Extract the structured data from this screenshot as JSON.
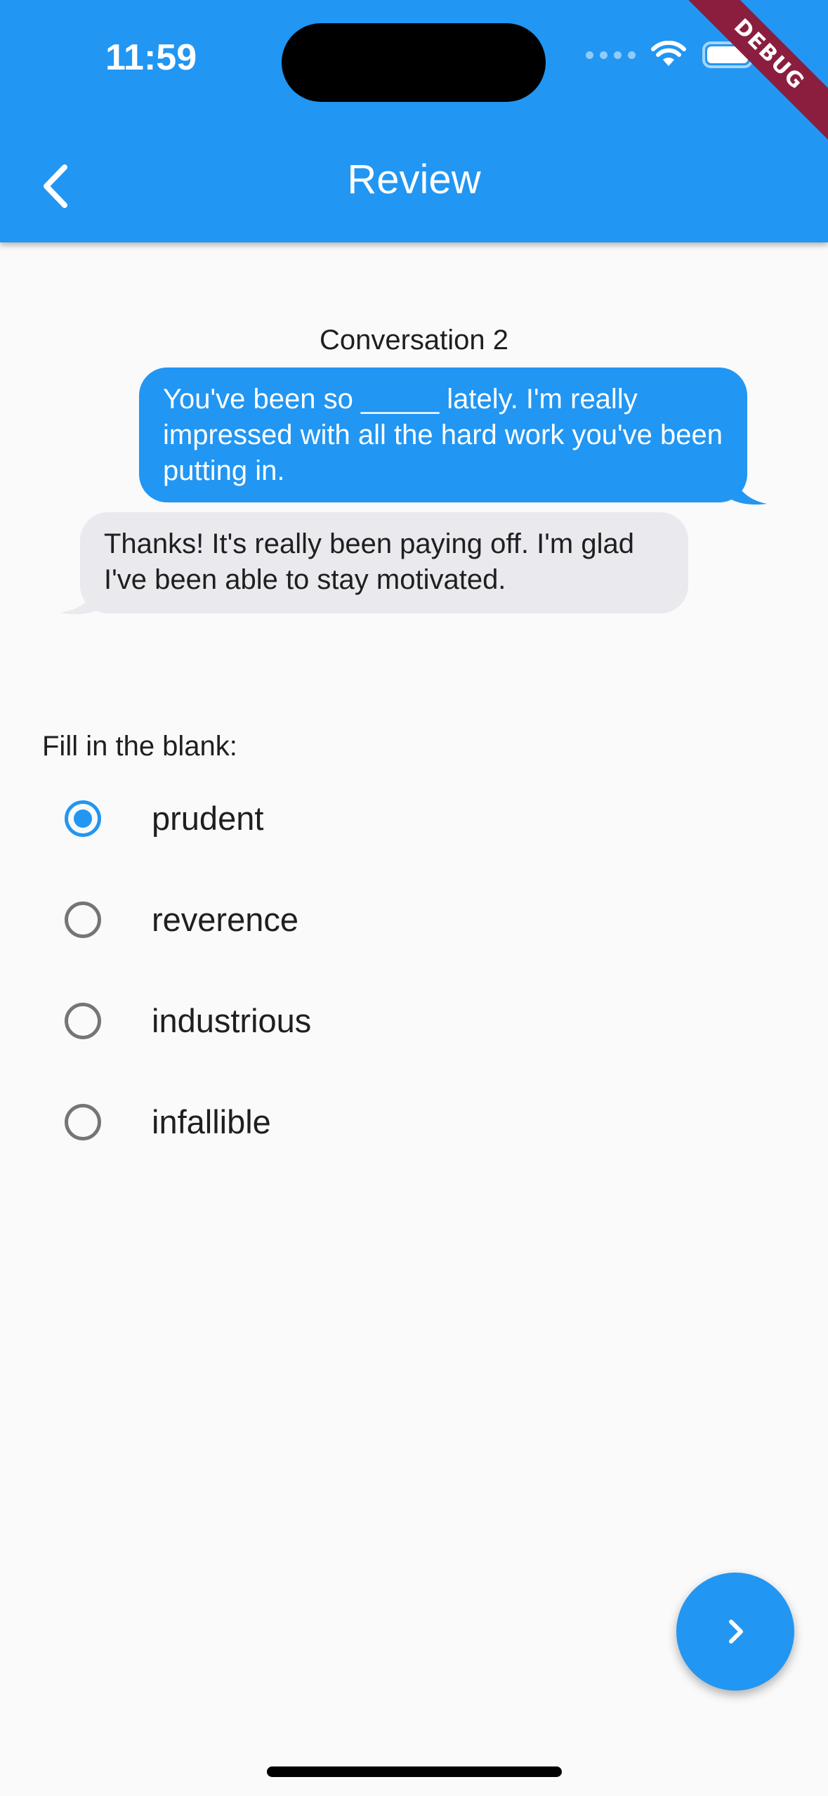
{
  "status_bar": {
    "time": "11:59",
    "debug_label": "DEBUG"
  },
  "app_bar": {
    "title": "Review",
    "back_icon": "chevron-left-icon",
    "background_color": "#2196f3"
  },
  "conversation": {
    "title": "Conversation 2",
    "messages": [
      {
        "side": "right",
        "text": "You've been so _____ lately. I'm really impressed with all the hard work you've been putting in."
      },
      {
        "side": "left",
        "text": "Thanks! It's really been paying off. I'm glad I've been able to stay motivated."
      }
    ]
  },
  "question": {
    "prompt": "Fill in the blank:",
    "options": [
      "prudent",
      "reverence",
      "industrious",
      "infallible"
    ],
    "selected": "prudent"
  },
  "fab": {
    "icon": "chevron-right-icon"
  },
  "colors": {
    "accent": "#2196f3",
    "incoming_bubble": "#e9e9ee",
    "debug_ribbon": "#8b1e3f"
  }
}
